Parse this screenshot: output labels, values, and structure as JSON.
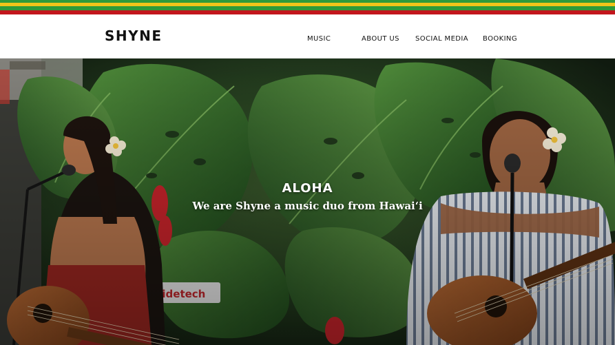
{
  "colors": {
    "stripe_1": "#2f9a3a",
    "stripe_2": "#f2c418",
    "stripe_3": "#2f9a3a",
    "stripe_4": "#c2161d",
    "header_bg": "#ffffff",
    "hero_text": "#ffffff"
  },
  "header": {
    "logo": "SHYNE",
    "nav": {
      "music": "MUSIC",
      "about": "ABOUT US",
      "social": "SOCIAL MEDIA",
      "booking": "BOOKING"
    }
  },
  "hero": {
    "title": "ALOHA",
    "subtitle": "We are Shyne a music duo from Hawaiʻi",
    "sign_text": "ridetech",
    "image_subject": "two-singers-with-ukuleles-in-front-of-monstera-leaves"
  }
}
